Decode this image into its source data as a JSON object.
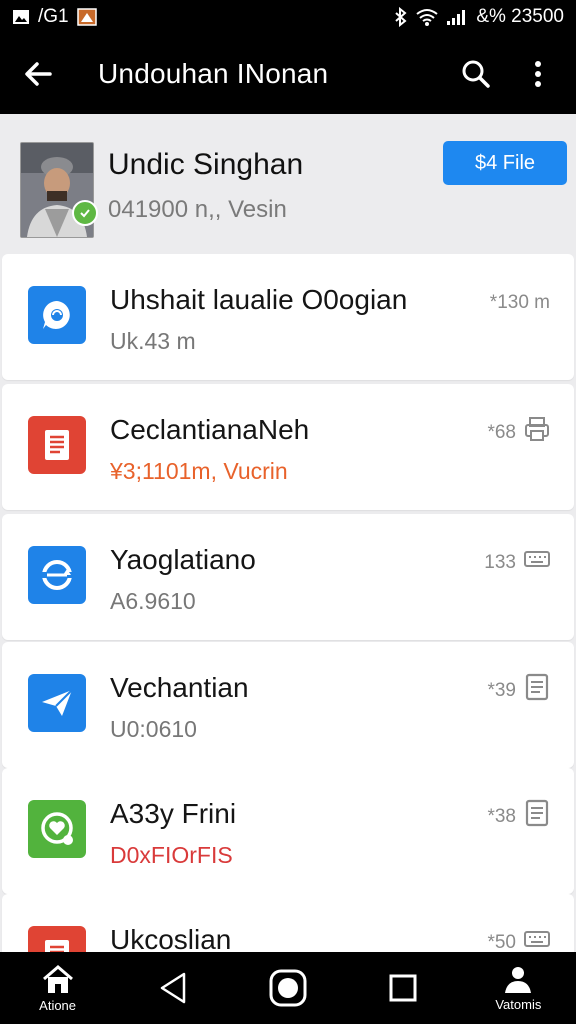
{
  "status_bar": {
    "left_text": "/G1",
    "right_text": "&%  23500"
  },
  "app_bar": {
    "title": "Undouhan INonan"
  },
  "header": {
    "name": "Undic Singhan",
    "subtitle": "041900 n,, Vesin",
    "button_label": "$4 File",
    "button_color": "#1e88f0"
  },
  "items": [
    {
      "title": "Uhshait laualie O0ogian",
      "subtitle": "Uk.43 m",
      "size": "*130 m",
      "icon": "chat-bubble-icon",
      "icon_color": "#1f83e8",
      "subtitle_color": "#777777",
      "action_icon": ""
    },
    {
      "title": "CeclantianaNeh",
      "subtitle": "¥3;1101m, Vucrin",
      "size": "*68",
      "icon": "document-icon",
      "icon_color": "#e04434",
      "subtitle_color": "#e8622b",
      "action_icon": "print-icon"
    },
    {
      "title": "Yaoglatiano",
      "subtitle": "A6.9610",
      "size": "133",
      "icon": "sync-icon",
      "icon_color": "#1f83e8",
      "subtitle_color": "#777777",
      "action_icon": "keyboard-icon"
    },
    {
      "title": "Vechantian",
      "subtitle": "U0:0610",
      "size": "*39",
      "icon": "send-icon",
      "icon_color": "#1f83e8",
      "subtitle_color": "#777777",
      "action_icon": "notes-icon"
    },
    {
      "title": "A33y Frini",
      "subtitle": "D0xFIOrFIS",
      "size": "*38",
      "icon": "heart-chat-icon",
      "icon_color": "#52b33d",
      "subtitle_color": "#d93a3a",
      "action_icon": "notes-icon"
    },
    {
      "title": "Ukcoslian",
      "subtitle": "",
      "size": "*50",
      "icon": "document-icon",
      "icon_color": "#e04434",
      "subtitle_color": "#777777",
      "action_icon": "keyboard-icon"
    }
  ],
  "bottom_nav": {
    "home_label": "Atione",
    "profile_label": "Vatomis"
  }
}
